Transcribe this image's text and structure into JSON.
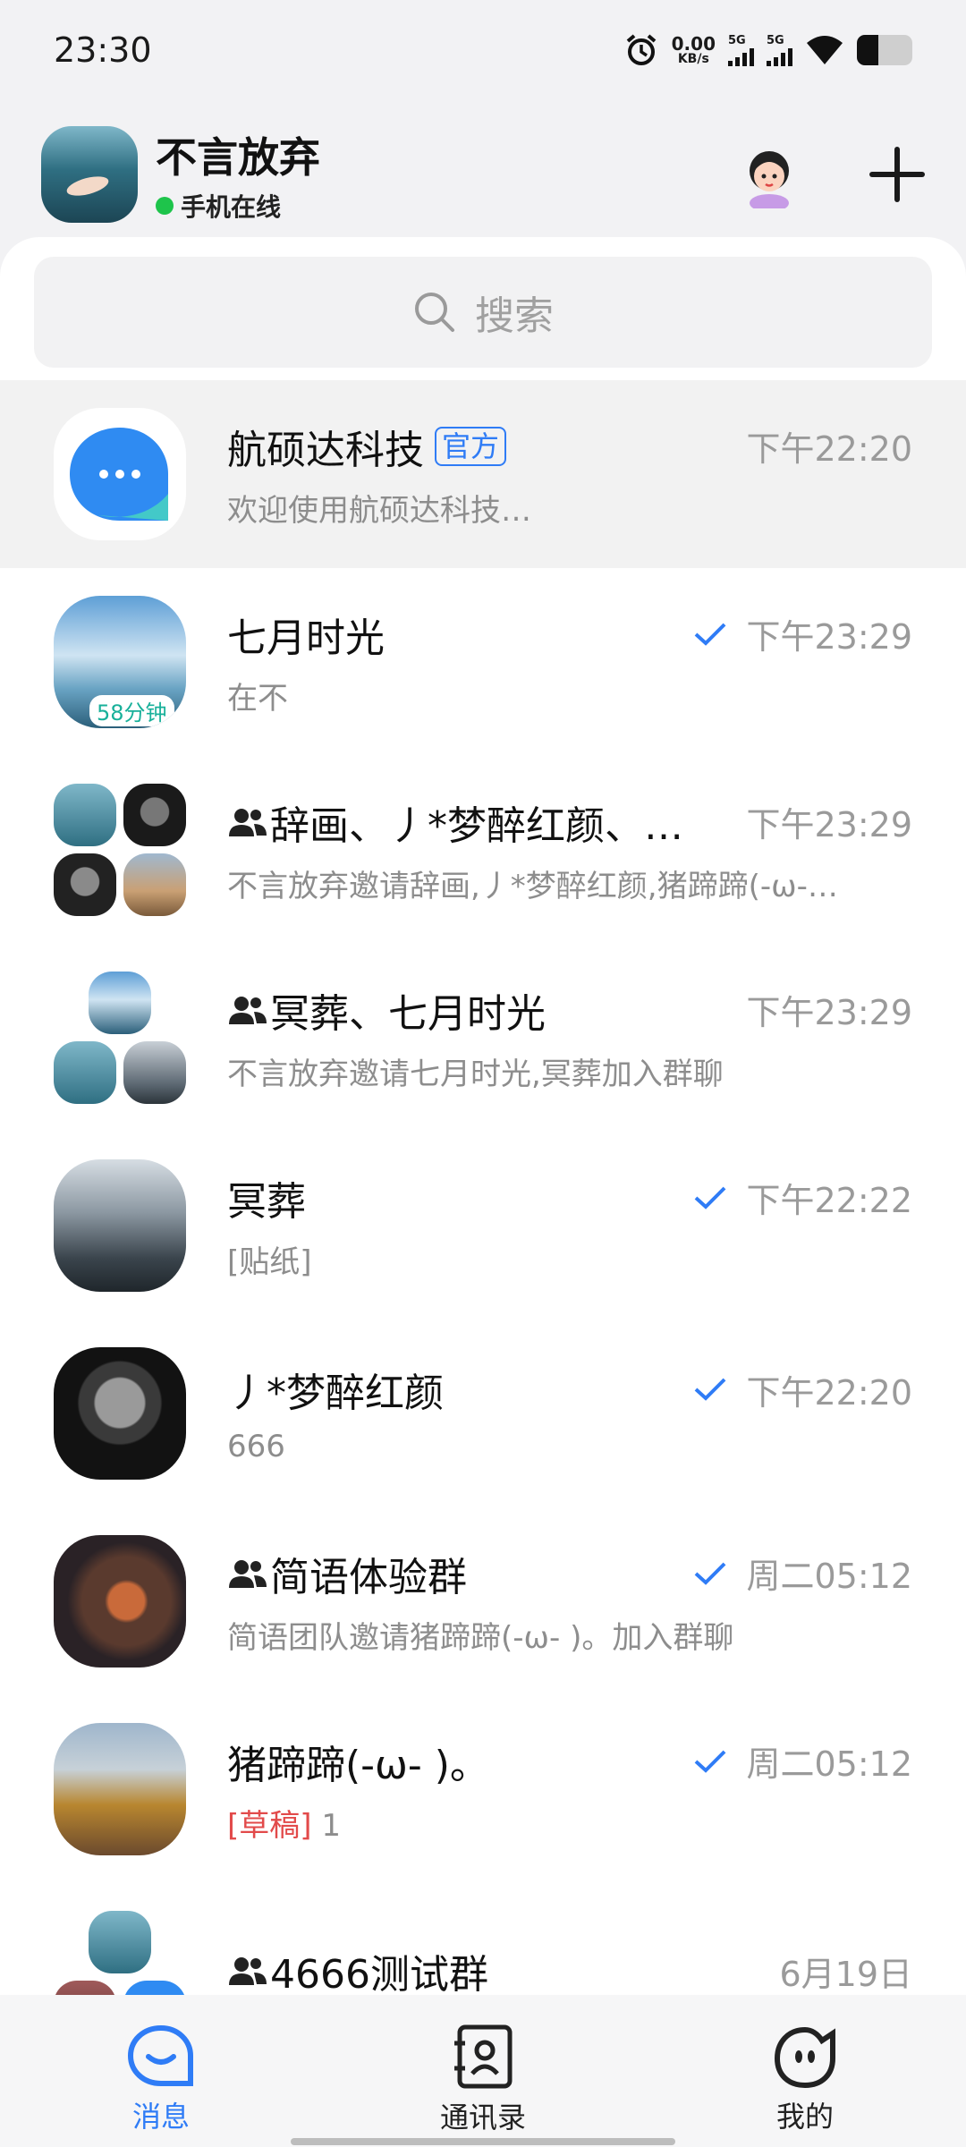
{
  "status_bar": {
    "time": "23:30",
    "net_speed": "0.00",
    "net_unit": "KB/s",
    "sig1": "5G",
    "sig2": "5G"
  },
  "header": {
    "name": "不言放弃",
    "status": "手机在线"
  },
  "search": {
    "placeholder": "搜索"
  },
  "chats": [
    {
      "title": "航硕达科技",
      "badge": "官方",
      "time": "下午22:20",
      "preview": "欢迎使用航硕达科技…"
    },
    {
      "title": "七月时光",
      "time": "下午23:29",
      "preview": "在不",
      "avatar_badge": "58分钟",
      "read": true
    },
    {
      "title": "辞画、丿*梦醉红颜、…",
      "time": "下午23:29",
      "preview": "不言放弃邀请辞画,丿*梦醉红颜,猪蹄蹄(-ω-…",
      "group": true
    },
    {
      "title": "冥葬、七月时光",
      "time": "下午23:29",
      "preview": "不言放弃邀请七月时光,冥葬加入群聊",
      "group": true
    },
    {
      "title": "冥葬",
      "time": "下午22:22",
      "preview": "[贴纸]",
      "read": true
    },
    {
      "title": "丿*梦醉红颜",
      "time": "下午22:20",
      "preview": "666",
      "read": true
    },
    {
      "title": "简语体验群",
      "time": "周二05:12",
      "preview": "简语团队邀请猪蹄蹄(-ω- )。加入群聊",
      "group": true,
      "read": true
    },
    {
      "title": "猪蹄蹄(-ω- )。",
      "time": "周二05:12",
      "draft_tag": "[草稿]",
      "preview": "1",
      "read": true
    },
    {
      "title": "4666测试群",
      "time": "6月19日",
      "preview": "",
      "group": true
    }
  ],
  "nav": {
    "messages": "消息",
    "contacts": "通讯录",
    "me": "我的"
  },
  "colors": {
    "accent": "#2f7cf6",
    "online": "#1ec44b",
    "draft": "#e24a4a"
  }
}
